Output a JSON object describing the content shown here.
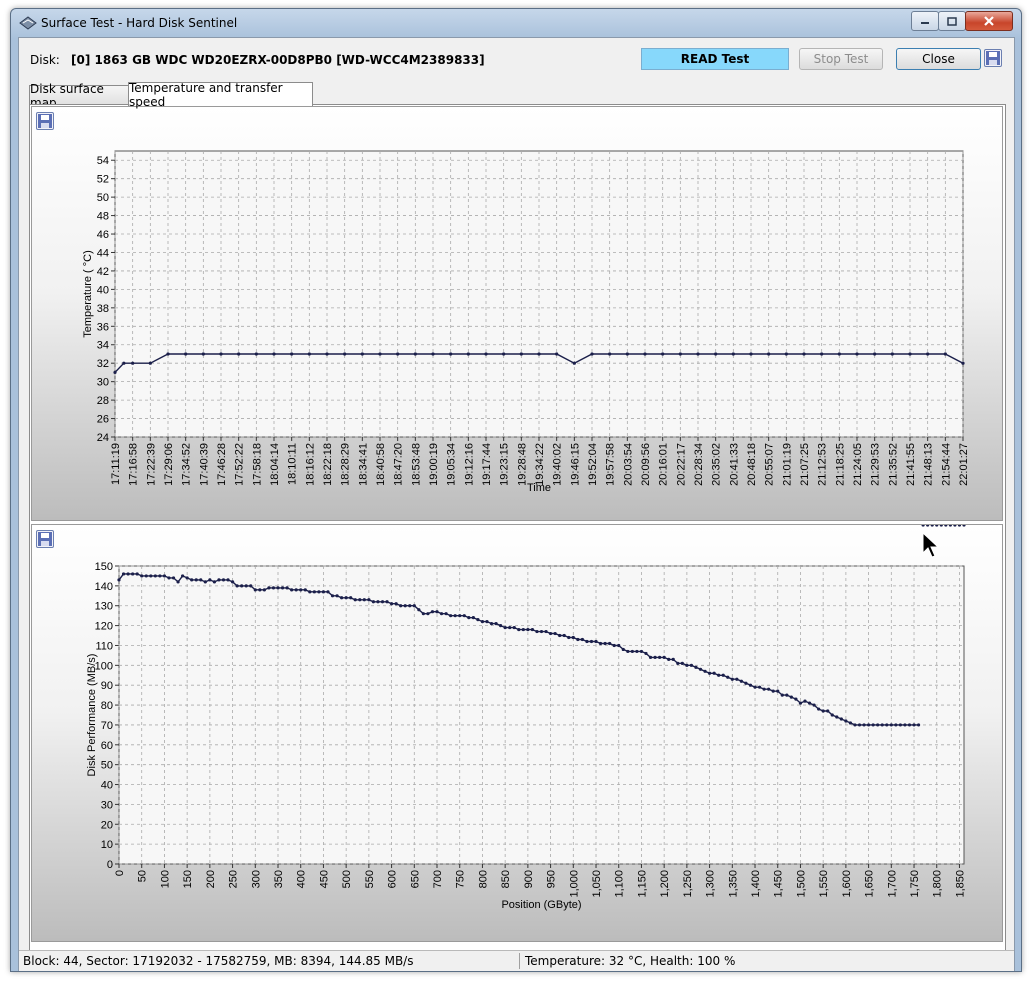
{
  "window": {
    "title": "Surface Test - Hard Disk Sentinel"
  },
  "header": {
    "disk_label": "Disk:",
    "disk_name": "[0] 1863 GB  WDC WD20EZRX-00D8PB0 [WD-WCC4M2389833]",
    "status": "READ Test",
    "stop_label": "Stop Test",
    "close_label": "Close"
  },
  "tabs": [
    {
      "label": "Disk surface map"
    },
    {
      "label": "Temperature and transfer speed"
    }
  ],
  "statusbar": {
    "left": "Block: 44, Sector: 17192032 - 17582759, MB: 8394, 144.85 MB/s",
    "right": "Temperature: 32  °C,  Health: 100 %"
  },
  "colors": {
    "series": "#1b1f4a",
    "status_bg": "#87d8fb"
  },
  "chart_data": [
    {
      "type": "line",
      "xlabel": "Time",
      "ylabel": "Temperature ( °C)",
      "ylim": [
        24,
        55
      ],
      "yticks": [
        24,
        26,
        28,
        30,
        32,
        34,
        36,
        38,
        40,
        42,
        44,
        46,
        48,
        50,
        52,
        54
      ],
      "grid": true,
      "xticks": [
        "17:11:19",
        "17:16:58",
        "17:22:39",
        "17:29:06",
        "17:34:52",
        "17:40:39",
        "17:46:28",
        "17:52:22",
        "17:58:18",
        "18:04:14",
        "18:10:11",
        "18:16:12",
        "18:22:18",
        "18:28:29",
        "18:34:41",
        "18:40:58",
        "18:47:20",
        "18:53:48",
        "19:00:19",
        "19:05:34",
        "19:12:16",
        "19:17:44",
        "19:23:15",
        "19:28:48",
        "19:34:22",
        "19:40:02",
        "19:46:15",
        "19:52:04",
        "19:57:58",
        "20:03:54",
        "20:09:56",
        "20:16:01",
        "20:22:17",
        "20:28:34",
        "20:35:02",
        "20:41:33",
        "20:48:18",
        "20:55:07",
        "21:01:19",
        "21:07:25",
        "21:12:53",
        "21:18:25",
        "21:24:05",
        "21:29:53",
        "21:35:52",
        "21:41:55",
        "21:48:13",
        "21:54:44",
        "22:01:27"
      ],
      "x": [
        0,
        0.5,
        1,
        2,
        3,
        4,
        5,
        6,
        7,
        8,
        9,
        10,
        11,
        12,
        13,
        14,
        15,
        16,
        17,
        18,
        19,
        20,
        21,
        22,
        23,
        24,
        25,
        26,
        27,
        28,
        29,
        30,
        31,
        32,
        33,
        34,
        35,
        36,
        37,
        38,
        39,
        40,
        41,
        42,
        43,
        44,
        45,
        46,
        47,
        48
      ],
      "values": [
        31,
        32,
        32,
        32,
        33,
        33,
        33,
        33,
        33,
        33,
        33,
        33,
        33,
        33,
        33,
        33,
        33,
        33,
        33,
        33,
        33,
        33,
        33,
        33,
        33,
        33,
        33,
        32,
        33,
        33,
        33,
        33,
        33,
        33,
        33,
        33,
        33,
        33,
        33,
        33,
        33,
        33,
        33,
        33,
        33,
        33,
        33,
        33,
        33,
        32
      ]
    },
    {
      "type": "line",
      "xlabel": "Position (GByte)",
      "ylabel": "Disk Performance (MB/s)",
      "ylim": [
        0,
        150
      ],
      "yticks": [
        0,
        10,
        20,
        30,
        40,
        50,
        60,
        70,
        80,
        90,
        100,
        110,
        120,
        130,
        140,
        150
      ],
      "grid": true,
      "xticks": [
        "0",
        "50",
        "100",
        "150",
        "200",
        "250",
        "300",
        "350",
        "400",
        "450",
        "500",
        "550",
        "600",
        "650",
        "700",
        "750",
        "800",
        "850",
        "900",
        "950",
        "1,000",
        "1,050",
        "1,100",
        "1,150",
        "1,200",
        "1,250",
        "1,300",
        "1,350",
        "1,400",
        "1,450",
        "1,500",
        "1,550",
        "1,600",
        "1,650",
        "1,700",
        "1,750",
        "1,800",
        "1,850"
      ],
      "x": [
        0,
        10,
        20,
        30,
        40,
        50,
        60,
        70,
        80,
        90,
        100,
        110,
        120,
        130,
        140,
        150,
        160,
        170,
        180,
        190,
        200,
        210,
        220,
        230,
        240,
        250,
        260,
        270,
        280,
        290,
        300,
        310,
        320,
        330,
        340,
        350,
        360,
        370,
        380,
        390,
        400,
        410,
        420,
        430,
        440,
        450,
        460,
        470,
        480,
        490,
        500,
        510,
        520,
        530,
        540,
        550,
        560,
        570,
        580,
        590,
        600,
        610,
        620,
        630,
        640,
        650,
        660,
        670,
        680,
        690,
        700,
        710,
        720,
        730,
        740,
        750,
        760,
        770,
        780,
        790,
        800,
        810,
        820,
        830,
        840,
        850,
        860,
        870,
        880,
        890,
        900,
        910,
        920,
        930,
        940,
        950,
        960,
        970,
        980,
        990,
        1000,
        1010,
        1020,
        1030,
        1040,
        1050,
        1060,
        1070,
        1080,
        1090,
        1100,
        1110,
        1120,
        1130,
        1140,
        1150,
        1160,
        1170,
        1180,
        1190,
        1200,
        1210,
        1220,
        1230,
        1240,
        1250,
        1260,
        1270,
        1280,
        1290,
        1300,
        1310,
        1320,
        1330,
        1340,
        1350,
        1360,
        1370,
        1380,
        1390,
        1400,
        1410,
        1420,
        1430,
        1440,
        1450,
        1460,
        1470,
        1480,
        1490,
        1500,
        1510,
        1520,
        1530,
        1540,
        1550,
        1560,
        1570,
        1580,
        1590,
        1600,
        1610,
        1620,
        1630,
        1640,
        1650,
        1660,
        1670,
        1680,
        1690,
        1700,
        1710,
        1720,
        1730,
        1740,
        1750,
        1760,
        1770,
        1780,
        1790,
        1800,
        1810,
        1820,
        1830,
        1840,
        1850,
        1860
      ],
      "values": [
        143,
        146,
        146,
        146,
        146,
        145,
        145,
        145,
        145,
        145,
        145,
        144,
        144,
        142,
        145,
        144,
        143,
        143,
        143,
        142,
        143,
        142,
        143,
        143,
        143,
        142,
        140,
        140,
        140,
        140,
        138,
        138,
        138,
        139,
        139,
        139,
        139,
        139,
        138,
        138,
        138,
        138,
        137,
        137,
        137,
        137,
        137,
        135,
        135,
        134,
        134,
        134,
        133,
        133,
        133,
        133,
        132,
        132,
        132,
        132,
        131,
        131,
        130,
        130,
        130,
        130,
        128,
        126,
        126,
        127,
        127,
        126,
        126,
        125,
        125,
        125,
        125,
        124,
        124,
        123,
        122,
        122,
        121,
        121,
        120,
        119,
        119,
        119,
        118,
        118,
        118,
        118,
        117,
        117,
        117,
        116,
        116,
        115,
        115,
        114,
        114,
        113,
        113,
        112,
        112,
        112,
        111,
        111,
        111,
        110,
        110,
        108,
        107,
        107,
        107,
        107,
        106,
        104,
        104,
        104,
        104,
        103,
        103,
        101,
        101,
        100,
        100,
        99,
        98,
        97,
        96,
        96,
        95,
        95,
        94,
        93,
        93,
        92,
        91,
        90,
        89,
        89,
        88,
        88,
        87,
        87,
        85,
        85,
        84,
        83,
        81,
        82,
        81,
        80,
        78,
        77,
        77,
        75,
        74,
        73,
        72,
        71,
        70,
        70,
        70,
        70,
        70,
        70,
        70,
        70,
        70,
        70,
        70,
        70,
        70,
        70,
        70
      ]
    }
  ]
}
